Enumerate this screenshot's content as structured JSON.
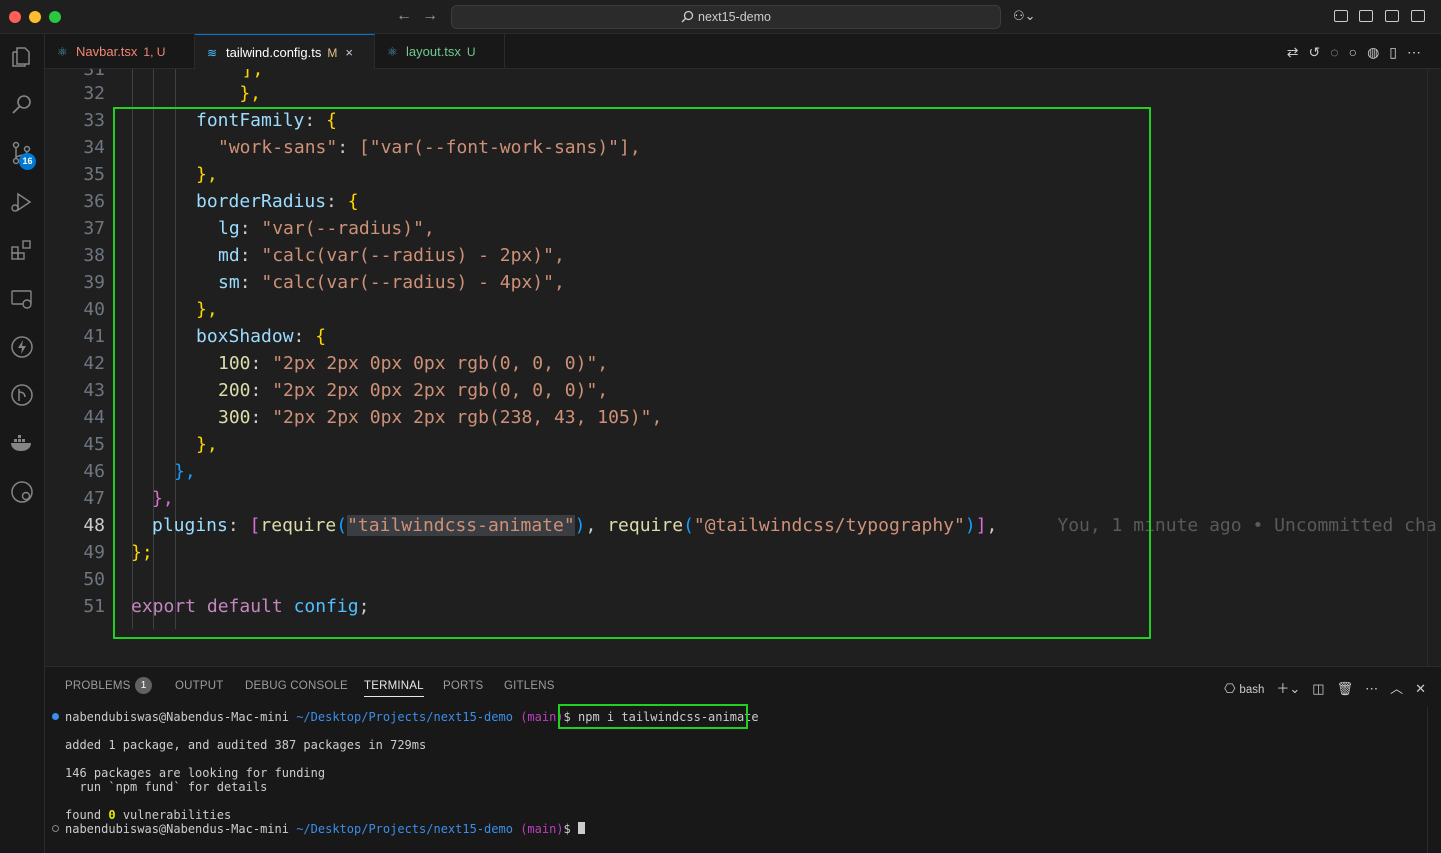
{
  "window": {
    "search_text": "next15-demo"
  },
  "activity_bar": {
    "source_control_badge": "16",
    "icons": [
      "explorer-icon",
      "search-icon",
      "source-control-icon",
      "run-debug-icon",
      "extensions-icon",
      "remote-explorer-icon",
      "thunder-client-icon",
      "gitlens-icon",
      "docker-icon",
      "gitlens-inspect-icon"
    ]
  },
  "tabs": [
    {
      "label": "Navbar.tsx",
      "status": "1, U",
      "color": "#f48771",
      "icon_color": "#519aba"
    },
    {
      "label": "tailwind.config.ts",
      "status": "M",
      "color": "#ffffff",
      "icon_color": "#4fc1ff",
      "active": true,
      "close": "×"
    },
    {
      "label": "layout.tsx",
      "status": "U",
      "color": "#73c991",
      "icon_color": "#519aba"
    }
  ],
  "editor": {
    "lines": [
      {
        "n": "31",
        "t": "  ];"
      },
      {
        "n": "32",
        "t": "    },"
      },
      {
        "n": "33",
        "key": "fontFamily",
        "open": "{"
      },
      {
        "n": "34",
        "key": "\"work-sans\"",
        "value": "[\"var(--font-work-sans)\"],"
      },
      {
        "n": "35",
        "close": "},"
      },
      {
        "n": "36",
        "key": "borderRadius",
        "open": "{"
      },
      {
        "n": "37",
        "key": "lg",
        "value": "\"var(--radius)\","
      },
      {
        "n": "38",
        "key": "md",
        "value": "\"calc(var(--radius) - 2px)\","
      },
      {
        "n": "39",
        "key": "sm",
        "value": "\"calc(var(--radius) - 4px)\","
      },
      {
        "n": "40",
        "close": "},"
      },
      {
        "n": "41",
        "key": "boxShadow",
        "open": "{"
      },
      {
        "n": "42",
        "key": "100",
        "value": "\"2px 2px 0px 0px rgb(0, 0, 0)\","
      },
      {
        "n": "43",
        "key": "200",
        "value": "\"2px 2px 0px 2px rgb(0, 0, 0)\","
      },
      {
        "n": "44",
        "key": "300",
        "value": "\"2px 2px 0px 2px rgb(238, 43, 105)\","
      },
      {
        "n": "45",
        "close": "},"
      },
      {
        "n": "46",
        "close": "},"
      },
      {
        "n": "47",
        "close": "},"
      },
      {
        "n": "48",
        "key": "plugins"
      },
      {
        "n": "49",
        "close": "};"
      },
      {
        "n": "50"
      },
      {
        "n": "51"
      }
    ],
    "plugins_line": {
      "require1": "require",
      "arg1": "\"tailwindcss-animate\"",
      "require2": "require",
      "arg2": "\"@tailwindcss/typography\"",
      "blame": "You, 1 minute ago • Uncommitted cha"
    },
    "export_line": {
      "kw1": "export",
      "kw2": "default",
      "name": "config"
    }
  },
  "panel": {
    "tabs": [
      "PROBLEMS",
      "OUTPUT",
      "DEBUG CONSOLE",
      "TERMINAL",
      "PORTS",
      "GITLENS"
    ],
    "problems_count": "1",
    "shell": "bash",
    "terminal": {
      "prompt_user": "nabendubiswas@Nabendus-Mac-mini",
      "prompt_path": "~/Desktop/Projects/next15-demo",
      "prompt_branch": "(main)",
      "prompt_symbol": "$",
      "command": "npm i tailwindcss-animate",
      "output1": "added 1 package, and audited 387 packages in 729ms",
      "output2": "146 packages are looking for funding",
      "output3": "  run `npm fund` for details",
      "output4_a": "found ",
      "output4_b": "0",
      "output4_c": " vulnerabilities"
    }
  },
  "colors": {
    "highlight_box": "#22d11f",
    "accent": "#0078d4"
  }
}
